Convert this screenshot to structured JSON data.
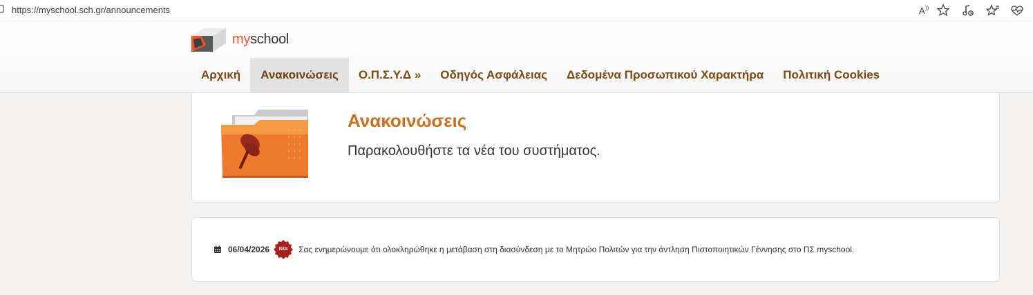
{
  "browser": {
    "url": "https://myschool.sch.gr/announcements",
    "icons": [
      "read-aloud-icon",
      "favorite-star-icon",
      "media-icon",
      "favorites-icon",
      "health-icon"
    ]
  },
  "site": {
    "logo": {
      "my": "my",
      "school": "school"
    },
    "nav": [
      {
        "label": "Αρχική",
        "active": false
      },
      {
        "label": "Ανακοινώσεις",
        "active": true
      },
      {
        "label": "Ο.Π.Σ.Υ.Δ »",
        "active": false
      },
      {
        "label": "Οδηγός Ασφάλειας",
        "active": false
      },
      {
        "label": "Δεδομένα Προσωπικού Χαρακτήρα",
        "active": false
      },
      {
        "label": "Πολιτική Cookies",
        "active": false
      }
    ]
  },
  "hero": {
    "title": "Ανακοινώσεις",
    "subtitle": "Παρακολουθήστε τα νέα του συστήματος.",
    "icon": "pinned-folder-icon"
  },
  "announcements": [
    {
      "date": "06/04/2026",
      "badge": "Νέα",
      "text": "Σας ενημερώνουμε ότι ολοκληρώθηκε η μετάβαση στη διασύνδεση με το Μητρώο Πολιτών για την άντληση Πιστοποιητικών Γέννησης στο ΠΣ myschool."
    }
  ],
  "colors": {
    "brand_orange": "#e8542a",
    "nav_text": "#7a4a14",
    "title_orange": "#c8701e",
    "badge_red": "#a8201a"
  }
}
